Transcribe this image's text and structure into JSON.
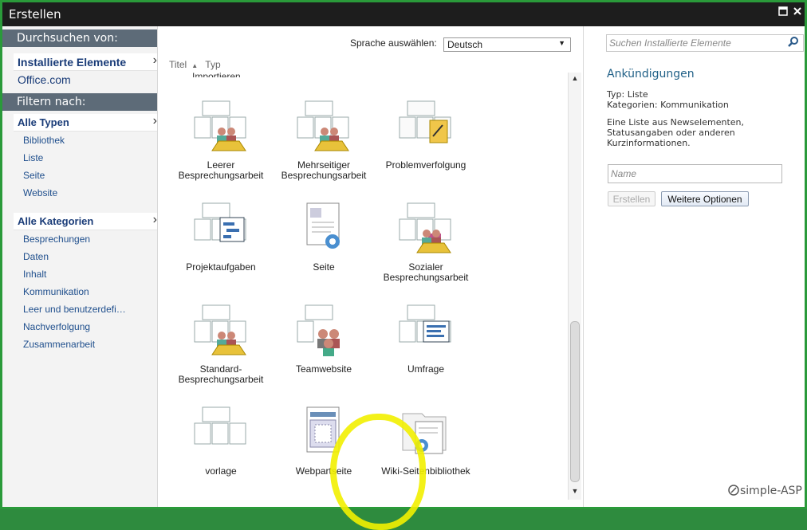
{
  "window": {
    "title": "Erstellen",
    "maximize_icon": "maximize-icon",
    "close_icon": "close-icon"
  },
  "sidebar": {
    "browse_heading": "Durchsuchen von:",
    "browse_items": [
      {
        "label": "Installierte Elemente",
        "selected": true
      },
      {
        "label": "Office.com",
        "selected": false
      }
    ],
    "filter_heading": "Filtern nach:",
    "type_group": {
      "label": "Alle Typen",
      "items": [
        "Bibliothek",
        "Liste",
        "Seite",
        "Website"
      ]
    },
    "category_group": {
      "label": "Alle Kategorien",
      "items": [
        "Besprechungen",
        "Daten",
        "Inhalt",
        "Kommunikation",
        "Leer und benutzerdefi…",
        "Nachverfolgung",
        "Zusammenarbeit"
      ]
    }
  },
  "main": {
    "language_label": "Sprache auswählen:",
    "language_value": "Deutsch",
    "sort": {
      "title": "Titel",
      "type": "Typ"
    },
    "truncated_item": "Importieren",
    "tiles": [
      {
        "label": "Leerer Besprechungsarbeit",
        "icon": "meeting-icon"
      },
      {
        "label": "Mehrseitiger Besprechungsarbeit",
        "icon": "meeting-multi-icon"
      },
      {
        "label": "Problemverfolgung",
        "icon": "issue-tracking-icon"
      },
      {
        "label": "Projektaufgaben",
        "icon": "project-tasks-icon"
      },
      {
        "label": "Seite",
        "icon": "page-icon"
      },
      {
        "label": "Sozialer Besprechungsarbeit",
        "icon": "social-meeting-icon"
      },
      {
        "label": "Standard-Besprechungsarbeit",
        "icon": "standard-meeting-icon"
      },
      {
        "label": "Teamwebsite",
        "icon": "team-site-icon"
      },
      {
        "label": "Umfrage",
        "icon": "survey-icon"
      },
      {
        "label": "vorlage",
        "icon": "template-icon"
      },
      {
        "label": "Webpartseite",
        "icon": "webpart-page-icon"
      },
      {
        "label": "Wiki-Seitenbibliothek",
        "icon": "wiki-library-icon"
      }
    ]
  },
  "details": {
    "search_placeholder": "Suchen Installierte Elemente",
    "heading": "Ankündigungen",
    "type_line": "Typ: Liste",
    "category_line": "Kategorien: Kommunikation",
    "description": "Eine Liste aus Newselementen, Statusangaben oder anderen Kurzinformationen.",
    "name_placeholder": "Name",
    "create_button": "Erstellen",
    "more_options_button": "Weitere Optionen"
  },
  "watermark": {
    "brand": "simple-ASP"
  },
  "colors": {
    "highlight": "#f2ef00",
    "titlebar": "#1d1d1d",
    "section_header": "#5d6b78"
  }
}
